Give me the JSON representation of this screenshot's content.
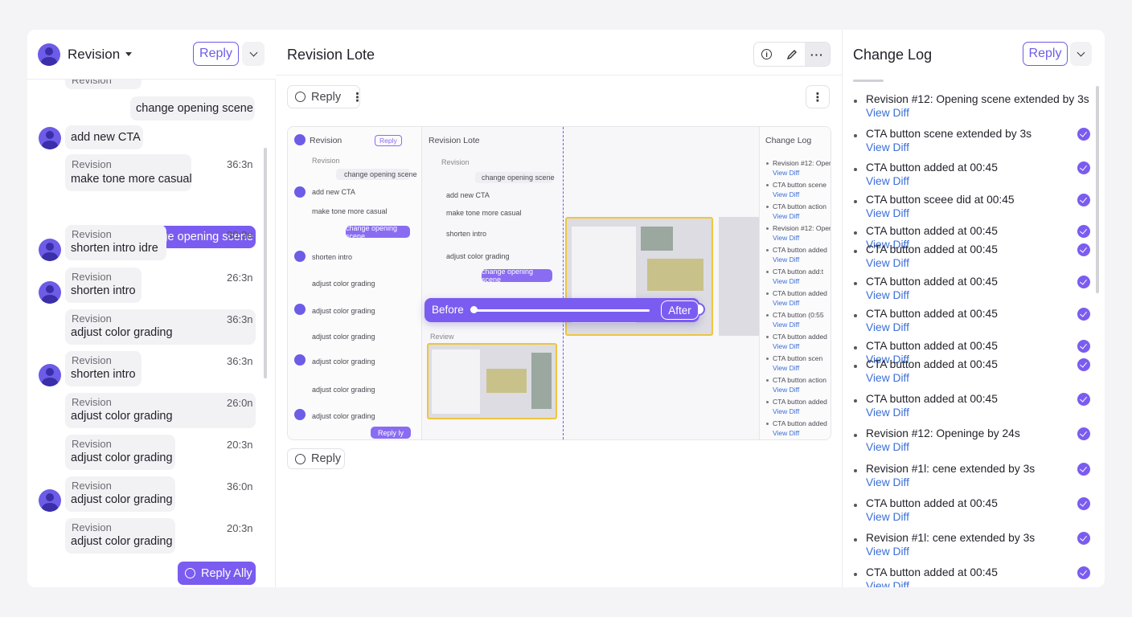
{
  "left": {
    "title": "Revision",
    "reply_label": "Reply",
    "reply_all_label": "Reply Ally",
    "top_clip": "Revision",
    "messages": [
      {
        "kind": "plain",
        "text": "change opening scene"
      },
      {
        "kind": "avatar",
        "text": "add new CTA"
      },
      {
        "kind": "labeled",
        "label": "Revision",
        "text": "make tone more casual",
        "time": "36:3n"
      },
      {
        "kind": "highlight",
        "text": "change opening scene"
      },
      {
        "kind": "avatar-labeled",
        "label": "Revision",
        "text": "shorten intro idre",
        "time": "30:3n"
      },
      {
        "kind": "avatar-labeled",
        "label": "Revision",
        "text": "shorten intro",
        "time": "26:3n"
      },
      {
        "kind": "labeled",
        "label": "Revision",
        "text": "adjust color grading",
        "time": "36:3n"
      },
      {
        "kind": "avatar-labeled",
        "label": "Revision",
        "text": "shorten intro",
        "time": "36:3n"
      },
      {
        "kind": "labeled",
        "label": "Revision",
        "text": "adjust color grading",
        "time": "26:0n"
      },
      {
        "kind": "labeled",
        "label": "Revision",
        "text": "adjust color grading",
        "time": "20:3n"
      },
      {
        "kind": "avatar-labeled",
        "label": "Revision",
        "text": "adjust color grading",
        "time": "36:0n"
      },
      {
        "kind": "labeled",
        "label": "Revision",
        "text": "adjust color grading",
        "time": "20:3n"
      }
    ]
  },
  "mid": {
    "title": "Revision Lote",
    "reply_label": "Reply",
    "reply_bottom_label": "Reply",
    "tools": {
      "info": "i",
      "more": "···"
    },
    "kebab": "⋮",
    "slider": {
      "before": "Before",
      "after": "After",
      "position": 0.5
    },
    "mini": {
      "left_title": "Revision",
      "left_reply": "Reply",
      "mid_title": "Revision Lote",
      "right_title": "Change Log",
      "before_label": "Revision",
      "lines": [
        "change opening scene",
        "add new CTA",
        "make tone more casual",
        "shorten intro",
        "adjust color grading"
      ],
      "purple": "change opening scene",
      "mid_purple": "change opening scene",
      "reply_ly": "Reply ly",
      "review": "Review",
      "right_items": [
        "Revision #12: Openi",
        "CTA button scene",
        "CTA button action",
        "Revision #12: Open",
        "CTA button added",
        "CTA button add:t",
        "CTA button added",
        "CTA button (0:55",
        "CTA button added",
        "CTA button scen",
        "CTA button action",
        "CTA button added",
        "CTA button added"
      ],
      "view_diff": "View Diff"
    }
  },
  "right": {
    "title": "Change Log",
    "reply_label": "Reply",
    "view_diff": "View Diff",
    "items": [
      {
        "text": "Revision #12: Opening scene extended by 3s",
        "checked": false
      },
      {
        "text": "CTA button scene extended by 3s",
        "checked": true
      },
      {
        "text": "CTA button added at 00:45",
        "checked": true
      },
      {
        "text": "CTA button sceee did at 00:45",
        "checked": true
      },
      {
        "text": "CTA button added at 00:45",
        "checked": true
      },
      {
        "text": "CTA button added at 00:45",
        "checked": true
      },
      {
        "text": "CTA button added at 00:45",
        "checked": true
      },
      {
        "text": "CTA button added at 00:45",
        "checked": true
      },
      {
        "text": "CTA button added at 00:45",
        "checked": true
      },
      {
        "text": "CTA button added at 00:45",
        "checked": true
      },
      {
        "text": "CTA button added at 00:45",
        "checked": true
      },
      {
        "text": "Revision #12: Openinge by 24s",
        "checked": true
      },
      {
        "text": "Revision #1l: cene extended by 3s",
        "checked": true
      },
      {
        "text": "CTA button added at 00:45",
        "checked": true
      },
      {
        "text": "Revision #1l: cene extended by 3s",
        "checked": true
      },
      {
        "text": "CTA button added at 00:45",
        "checked": true
      }
    ]
  },
  "colors": {
    "accent": "#7b5cf0",
    "link": "#3b6fd6",
    "highlight": "#f0c53c"
  }
}
